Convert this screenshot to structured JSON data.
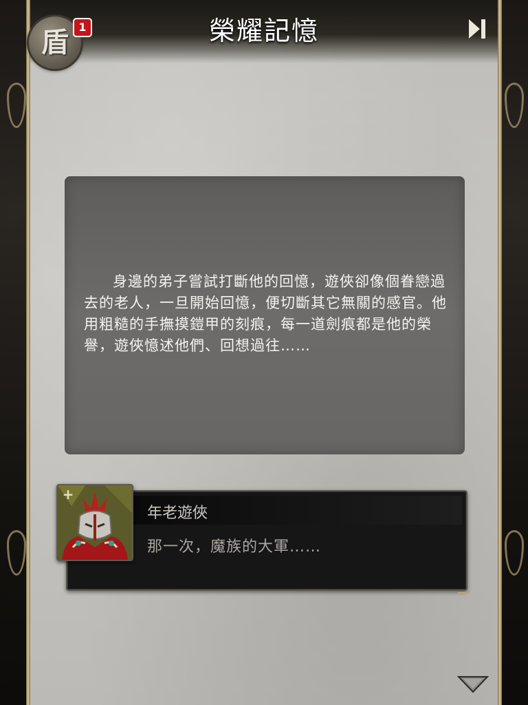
{
  "header": {
    "title": "榮耀記憶",
    "back_glyph": "盾",
    "badge_count": "1",
    "skip_icon": "skip-forward-icon"
  },
  "narration": {
    "text": "身邊的弟子嘗試打斷他的回憶，遊俠卻像個眷戀過去的老人，一旦開始回憶，便切斷其它無關的感官。他用粗糙的手撫摸鎧甲的刻痕，每一道劍痕都是他的榮譽，遊俠憶述他們、回想過往……"
  },
  "dialogue": {
    "speaker": "年老遊俠",
    "line": "那一次，魔族的大軍……",
    "portrait_icon": "elder-ranger-portrait",
    "plus_glyph": "+"
  },
  "footer": {
    "next_icon": "triangle-down-icon"
  },
  "colors": {
    "badge": "#c4141c",
    "title_text": "#ffffff",
    "narration_bg": "#676664",
    "dialogue_bg": "#161616",
    "frame_gold": "#d8c79a"
  }
}
